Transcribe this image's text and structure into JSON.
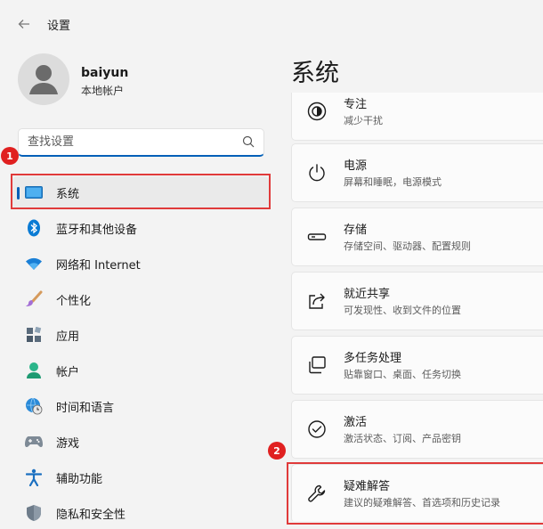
{
  "window": {
    "title": "设置",
    "back": "←"
  },
  "user": {
    "name": "baiyun",
    "account_type": "本地帐户"
  },
  "search": {
    "placeholder": "查找设置",
    "value": ""
  },
  "sidebar": {
    "items": [
      {
        "label": "系统",
        "selected": true
      },
      {
        "label": "蓝牙和其他设备"
      },
      {
        "label": "网络和 Internet"
      },
      {
        "label": "个性化"
      },
      {
        "label": "应用"
      },
      {
        "label": "帐户"
      },
      {
        "label": "时间和语言"
      },
      {
        "label": "游戏"
      },
      {
        "label": "辅助功能"
      },
      {
        "label": "隐私和安全性"
      }
    ]
  },
  "main": {
    "title": "系统",
    "cards": [
      {
        "title": "专注",
        "subtitle": "减少干扰"
      },
      {
        "title": "电源",
        "subtitle": "屏幕和睡眠，电源模式"
      },
      {
        "title": "存储",
        "subtitle": "存储空间、驱动器、配置规则"
      },
      {
        "title": "就近共享",
        "subtitle": "可发现性、收到文件的位置"
      },
      {
        "title": "多任务处理",
        "subtitle": "贴靠窗口、桌面、任务切换"
      },
      {
        "title": "激活",
        "subtitle": "激活状态、订阅、产品密钥"
      },
      {
        "title": "疑难解答",
        "subtitle": "建议的疑难解答、首选项和历史记录"
      }
    ]
  },
  "annotations": {
    "badge1": "1",
    "badge2": "2"
  },
  "colors": {
    "accent": "#005fb8",
    "annotation_red": "#e03a3a"
  }
}
